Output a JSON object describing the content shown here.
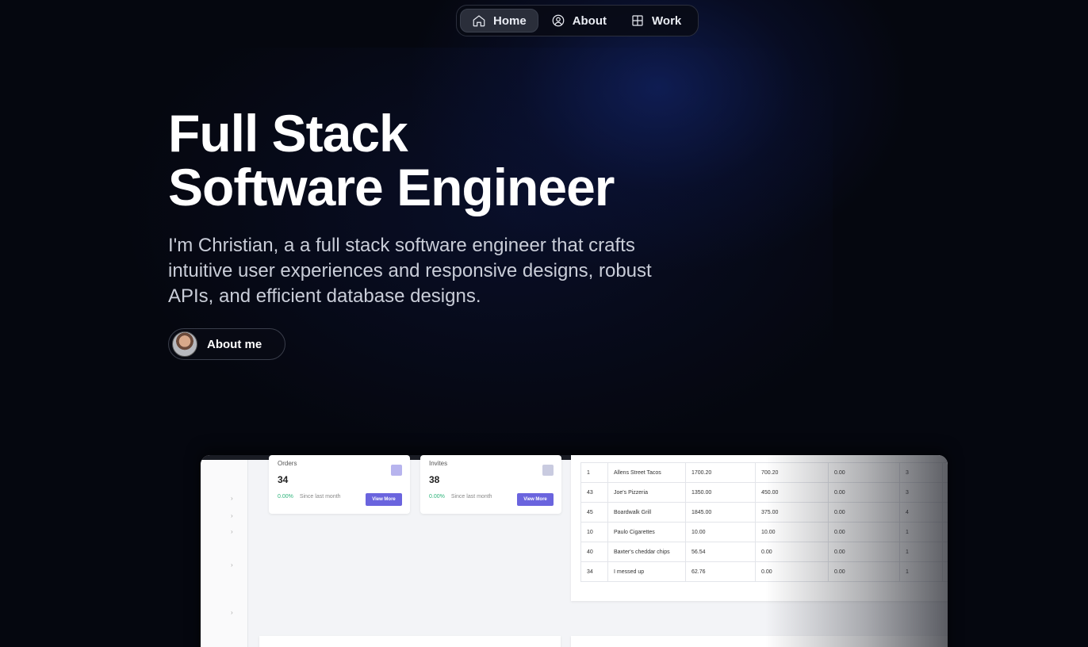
{
  "nav": {
    "items": [
      {
        "label": "Home",
        "icon": "home-icon",
        "active": true
      },
      {
        "label": "About",
        "icon": "user-circle-icon",
        "active": false
      },
      {
        "label": "Work",
        "icon": "grid-icon",
        "active": false
      }
    ]
  },
  "hero": {
    "title_line1": "Full Stack",
    "title_line2": "Software Engineer",
    "subtitle": "I'm Christian, a a full stack software engineer that crafts intuitive user experiences and responsive designs, robust APIs, and efficient database designs.",
    "button_label": "About me"
  },
  "preview": {
    "cards": [
      {
        "label": "Orders",
        "value": "34",
        "percent": "0.00%",
        "since": "Since last month",
        "button": "View More"
      },
      {
        "label": "Invites",
        "value": "38",
        "percent": "0.00%",
        "since": "Since last month",
        "button": "View More"
      }
    ],
    "table_rows": [
      [
        "1",
        "Allens Street Tacos",
        "1700.20",
        "700.20",
        "0.00",
        "3"
      ],
      [
        "43",
        "Joe's Pizzeria",
        "1350.00",
        "450.00",
        "0.00",
        "3"
      ],
      [
        "45",
        "Boardwalk Grill",
        "1845.00",
        "375.00",
        "0.00",
        "4"
      ],
      [
        "10",
        "Paulo Cigarettes",
        "10.00",
        "10.00",
        "0.00",
        "1"
      ],
      [
        "40",
        "Baxter's cheddar chips",
        "56.54",
        "0.00",
        "0.00",
        "1"
      ],
      [
        "34",
        "I messed up",
        "62.76",
        "0.00",
        "0.00",
        "1"
      ]
    ]
  },
  "colors": {
    "background": "#05070f",
    "accent_button": "#6a64de",
    "positive": "#2db37a"
  }
}
